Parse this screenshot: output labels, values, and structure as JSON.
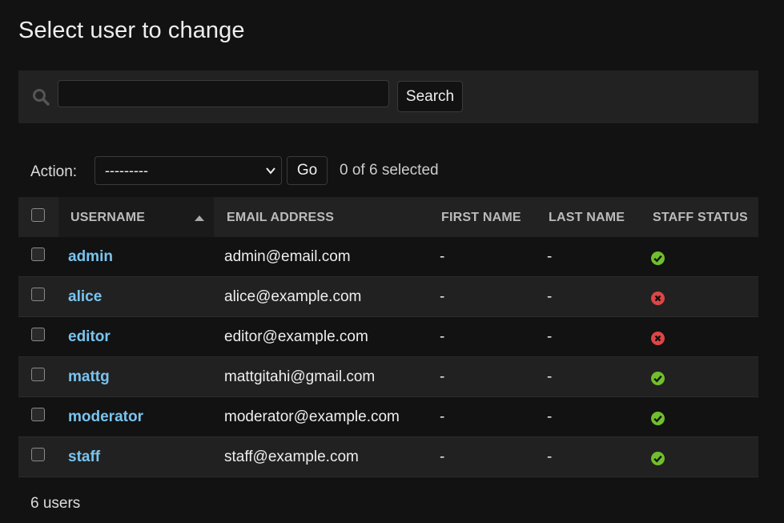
{
  "page": {
    "title": "Select user to change"
  },
  "search": {
    "placeholder": "",
    "value": "",
    "button_label": "Search",
    "icon": "search-icon"
  },
  "actions": {
    "label": "Action:",
    "selected_option": "---------",
    "go_label": "Go",
    "selected_text": "0 of 6 selected"
  },
  "table": {
    "columns": [
      "USERNAME",
      "EMAIL ADDRESS",
      "FIRST NAME",
      "LAST NAME",
      "STAFF STATUS"
    ],
    "sorted_column": "USERNAME",
    "sort_direction": "ascending",
    "rows": [
      {
        "username": "admin",
        "email": "admin@email.com",
        "first_name": "-",
        "last_name": "-",
        "staff": true
      },
      {
        "username": "alice",
        "email": "alice@example.com",
        "first_name": "-",
        "last_name": "-",
        "staff": false
      },
      {
        "username": "editor",
        "email": "editor@example.com",
        "first_name": "-",
        "last_name": "-",
        "staff": false
      },
      {
        "username": "mattg",
        "email": "mattgitahi@gmail.com",
        "first_name": "-",
        "last_name": "-",
        "staff": true
      },
      {
        "username": "moderator",
        "email": "moderator@example.com",
        "first_name": "-",
        "last_name": "-",
        "staff": true
      },
      {
        "username": "staff",
        "email": "staff@example.com",
        "first_name": "-",
        "last_name": "-",
        "staff": true
      }
    ]
  },
  "footer": {
    "count_text": "6 users"
  },
  "colors": {
    "background": "#121212",
    "link": "#79c4ef",
    "yes": "#70bf2b",
    "no": "#dd4646"
  },
  "icons": {
    "yes": "check-circle-icon",
    "no": "x-circle-icon",
    "sort": "sort-ascending-icon"
  }
}
